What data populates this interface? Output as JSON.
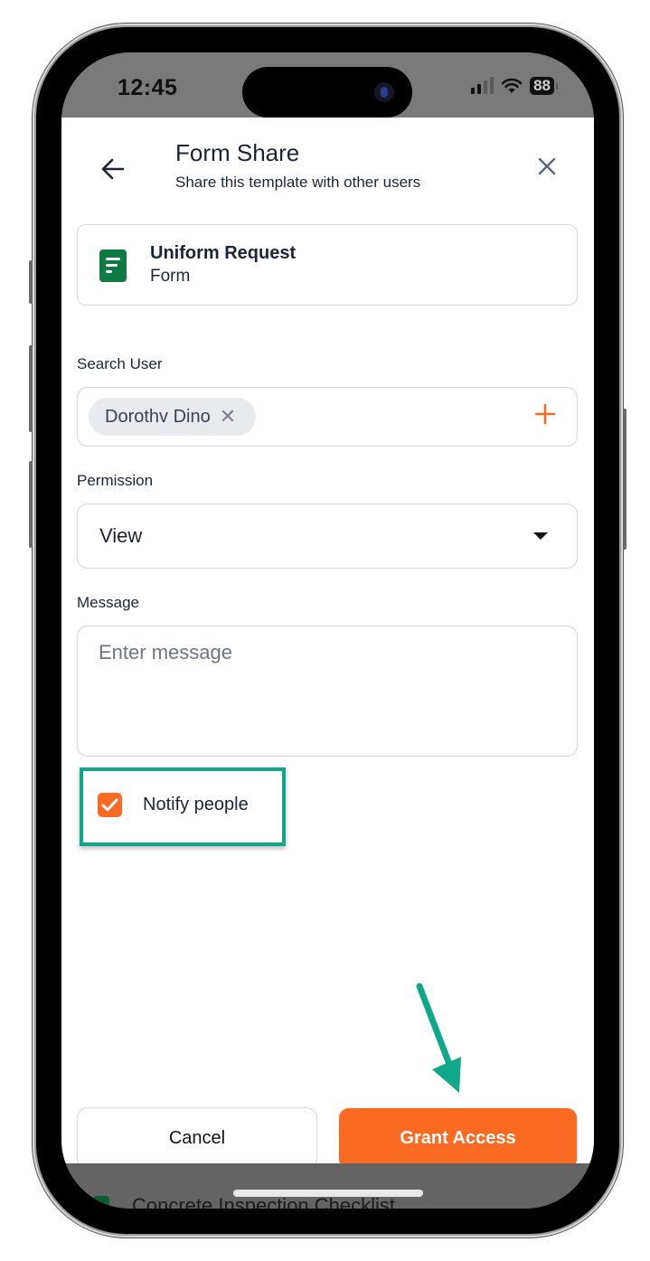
{
  "status_bar": {
    "time": "12:45",
    "battery": "88",
    "icons": [
      "signal-icon",
      "wifi-icon",
      "battery-icon"
    ]
  },
  "header": {
    "title": "Form Share",
    "subtitle": "Share this template with other users",
    "back_icon": "arrow-left-icon",
    "close_icon": "close-icon"
  },
  "template_card": {
    "icon": "form-document-icon",
    "name": "Uniform Request",
    "type": "Form",
    "icon_color": "#107a44"
  },
  "search_user": {
    "label": "Search User",
    "selected_users": [
      {
        "name": "Dorothv Dino"
      }
    ],
    "add_icon": "plus-icon"
  },
  "permission": {
    "label": "Permission",
    "value": "View"
  },
  "message": {
    "label": "Message",
    "value": "",
    "placeholder": "Enter message"
  },
  "notify": {
    "label": "Notify people",
    "checked": true
  },
  "actions": {
    "cancel_label": "Cancel",
    "grant_label": "Grant Access"
  },
  "background_list": {
    "item_label": "Concrete Inspection Checklist"
  },
  "colors": {
    "accent": "#fb6a22",
    "annotation": "#11a88a",
    "text": "#1c2434",
    "border": "#d3d6dc"
  }
}
